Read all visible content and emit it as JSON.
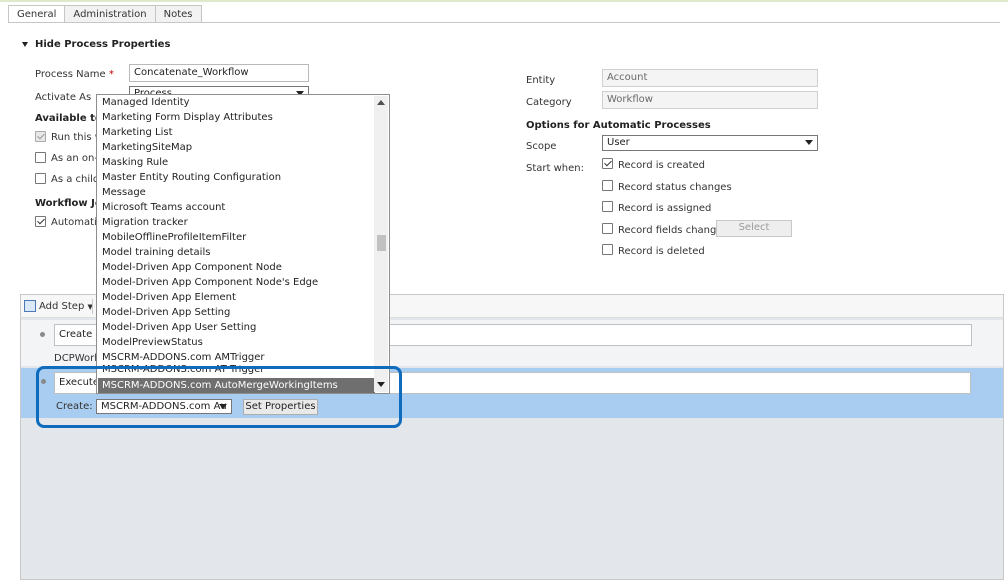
{
  "tabs": [
    {
      "label": "General",
      "active": true
    },
    {
      "label": "Administration",
      "active": false
    },
    {
      "label": "Notes",
      "active": false
    }
  ],
  "section": {
    "title": "Hide Process Properties"
  },
  "left": {
    "process_name_label": "Process Name",
    "required_mark": "*",
    "process_name_value": "Concatenate_Workflow",
    "activate_as_label": "Activate As",
    "activate_as_value": "Process",
    "available_label": "Available to R",
    "run_this_label": "Run this w",
    "on_demand_label": "As an on-d",
    "child_label": "As a child p",
    "workflow_job_label": "Workflow Job",
    "automatic_label": "Automatic"
  },
  "right": {
    "entity_label": "Entity",
    "entity_value": "Account",
    "category_label": "Category",
    "category_value": "Workflow",
    "options_title": "Options for Automatic Processes",
    "scope_label": "Scope",
    "scope_value": "User",
    "start_when_label": "Start when:",
    "checks": [
      {
        "label": "Record is created",
        "checked": true
      },
      {
        "label": "Record status changes",
        "checked": false
      },
      {
        "label": "Record is assigned",
        "checked": false
      },
      {
        "label": "Record fields change",
        "checked": false
      },
      {
        "label": "Record is deleted",
        "checked": false
      }
    ],
    "select_button": "Select"
  },
  "steps": {
    "add_step": "Add Step",
    "step1_text": "Create M",
    "step1_sub": "DCPWork",
    "step2_text": "ExecuteX",
    "create_label": "Create:",
    "create_value": "MSCRM-ADDONS.com Au",
    "set_properties": "Set Properties"
  },
  "dropdown": {
    "items": [
      "Managed Identity",
      "Marketing Form Display Attributes",
      "Marketing List",
      "MarketingSiteMap",
      "Masking Rule",
      "Master Entity Routing Configuration",
      "Message",
      "Microsoft Teams account",
      "Migration tracker",
      "MobileOfflineProfileItemFilter",
      "Model training details",
      "Model-Driven App Component Node",
      "Model-Driven App Component Node's Edge",
      "Model-Driven App Element",
      "Model-Driven App Setting",
      "Model-Driven App User Setting",
      "ModelPreviewStatus",
      "MSCRM-ADDONS.com AMTrigger",
      "MSCRM-ADDONS.com AT Trigger"
    ],
    "selected_item": "MSCRM-ADDONS.com AutoMergeWorkingItems"
  },
  "colors": {
    "highlight_border": "#0f6cbd",
    "selected_row": "#a9cdf0",
    "dropdown_selected": "#6f6f6f"
  }
}
